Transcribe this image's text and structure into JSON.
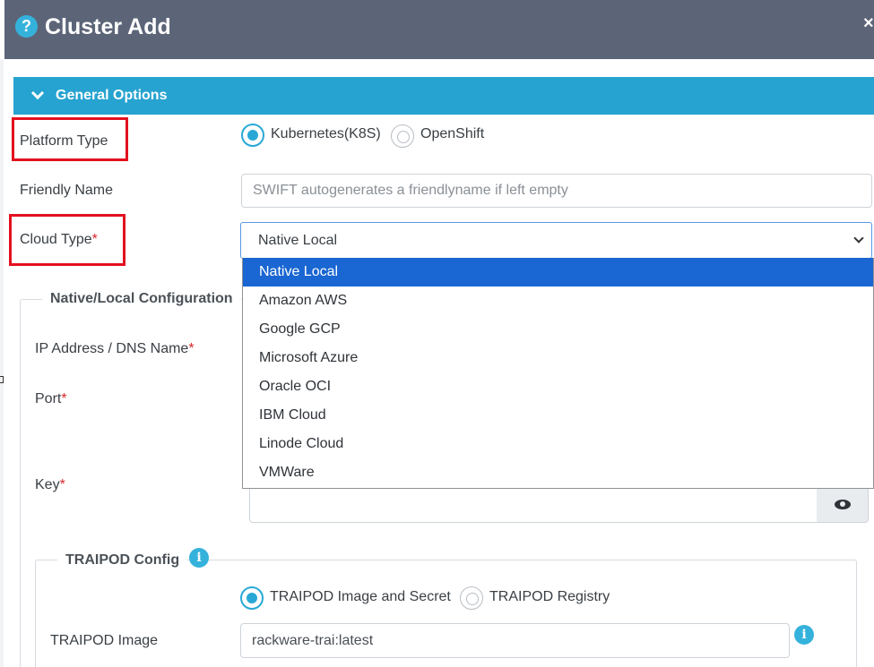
{
  "dialog": {
    "title": "Cluster Add",
    "help_icon": "question-circle-icon",
    "close_label": "×"
  },
  "section": {
    "title": "General Options",
    "icon": "chevron-down-icon"
  },
  "platform_type": {
    "label": "Platform Type",
    "options": [
      "Kubernetes(K8S)",
      "OpenShift"
    ],
    "selected": "Kubernetes(K8S)"
  },
  "friendly_name": {
    "label": "Friendly Name",
    "placeholder": "SWIFT autogenerates a friendlyname if left empty",
    "value": ""
  },
  "cloud_type": {
    "label": "Cloud Type",
    "required_mark": "*",
    "value": "Native Local",
    "options": [
      "Native Local",
      "Amazon AWS",
      "Google GCP",
      "Microsoft Azure",
      "Oracle OCI",
      "IBM Cloud",
      "Linode Cloud",
      "VMWare"
    ]
  },
  "native_config": {
    "legend": "Native/Local Configuration",
    "ip_label": "IP Address / DNS Name",
    "port_label": "Port",
    "key_label": "Key",
    "required_mark": "*",
    "key_toggle_icon": "eye-icon"
  },
  "traipod": {
    "legend": "TRAIPOD Config",
    "info_icon": "info-icon",
    "options": [
      "TRAIPOD Image and Secret",
      "TRAIPOD Registry"
    ],
    "selected": "TRAIPOD Image and Secret",
    "image_label": "TRAIPOD Image",
    "image_value": "rackware-trai:latest"
  },
  "colors": {
    "header_bg": "#5c6478",
    "section_bg": "#26a3d0",
    "accent": "#29a8d6",
    "highlight_box": "#e3101f",
    "dropdown_active": "#1a66d2"
  }
}
